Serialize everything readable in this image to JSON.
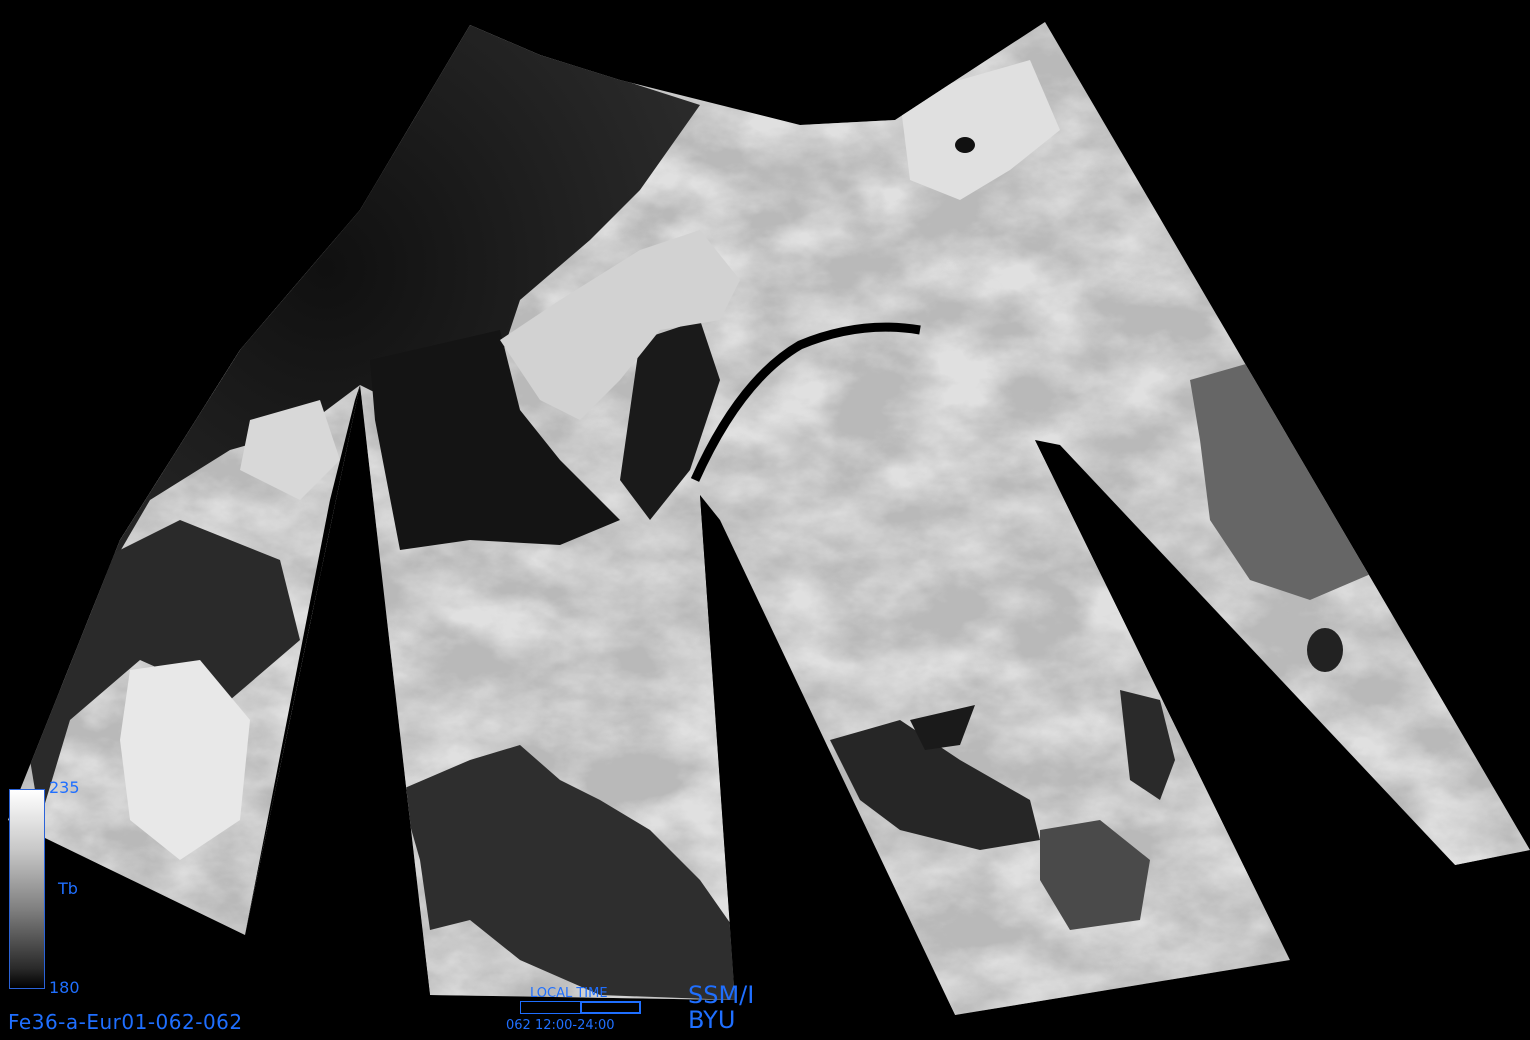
{
  "image": {
    "id_label": "Fe36-a-Eur01-062-062",
    "sensor": "SSM/I",
    "organization": "BYU"
  },
  "colorbar": {
    "max": "235",
    "min": "180",
    "unit": "Tb"
  },
  "local_time": {
    "title": "LOCAL TIME",
    "range": "062 12:00-24:00"
  },
  "colors": {
    "background": "#000000",
    "annotation": "#1f6fff"
  }
}
